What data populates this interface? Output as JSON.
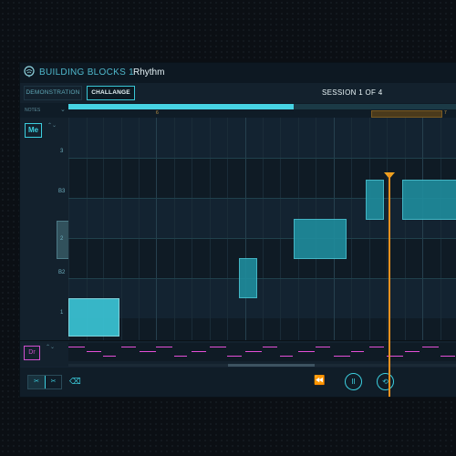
{
  "header": {
    "title": "BUILDING BLOCKS 1",
    "subtitle": "Rhythm"
  },
  "tabs": {
    "demonstration": "DEMONSTRATION",
    "challenge": "CHALLANGE"
  },
  "session": "SESSION 1 OF 4",
  "notes": {
    "label": "NOTES",
    "chevron": "⌄",
    "progress": 0.58
  },
  "ruler": {
    "marks": [
      "6",
      "7"
    ]
  },
  "side": {
    "me_label": "Me",
    "chevrons": "⌃⌄",
    "pitch_labels": [
      "3",
      "B3",
      "2",
      "B2",
      "1"
    ]
  },
  "drum": {
    "label": "Dr",
    "chevrons": "⌃⌄"
  },
  "footer": {
    "view_a": "✂",
    "view_b": "✂",
    "erase": "⌫",
    "rewind": "⏪",
    "pause": "II",
    "loop": "⟲"
  },
  "colors": {
    "accent": "#3ccfdf",
    "playhead": "#f0921f",
    "drum": "#e44fd8"
  }
}
